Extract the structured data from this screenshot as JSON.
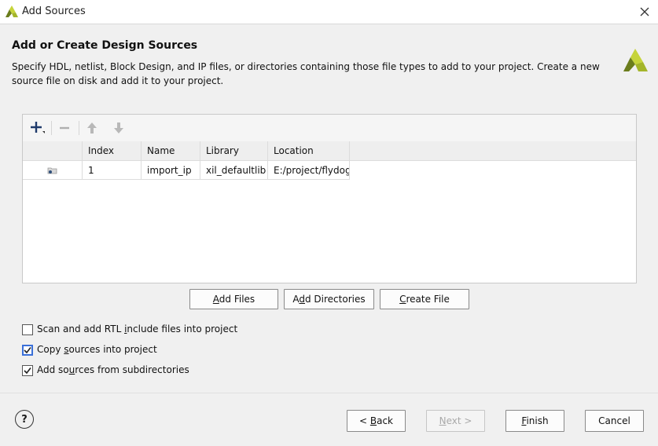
{
  "window": {
    "title": "Add Sources"
  },
  "header": {
    "heading": "Add or Create Design Sources",
    "description": "Specify HDL, netlist, Block Design, and IP files, or directories containing those file types to add to your project. Create a new source file on disk and add it to your project."
  },
  "table": {
    "columns": [
      "Index",
      "Name",
      "Library",
      "Location"
    ],
    "rows": [
      {
        "index": "1",
        "name": "import_ip",
        "library": "xil_defaultlib",
        "location": "E:/project/flydog"
      }
    ]
  },
  "actions": {
    "add_files": {
      "pre": "",
      "key": "A",
      "post": "dd Files"
    },
    "add_directories": {
      "pre": "A",
      "key": "d",
      "post": "d Directories"
    },
    "create_file": {
      "pre": "",
      "key": "C",
      "post": "reate File"
    }
  },
  "options": {
    "scan_rtl": {
      "pre": "Scan and add RTL ",
      "key": "i",
      "post": "nclude files into project",
      "checked": false
    },
    "copy_sources": {
      "pre": "Copy ",
      "key": "s",
      "post": "ources into project",
      "checked": true
    },
    "add_subdirs": {
      "pre": "Add so",
      "key": "u",
      "post": "rces from subdirectories",
      "checked": true
    }
  },
  "footer": {
    "help": "?",
    "back": {
      "pre": "< ",
      "key": "B",
      "post": "ack"
    },
    "next": {
      "pre": "",
      "key": "N",
      "post": "ext >"
    },
    "finish": {
      "pre": "",
      "key": "F",
      "post": "inish"
    },
    "cancel": "Cancel"
  },
  "colors": {
    "logo_light": "#c6d43a",
    "logo_dark": "#6b7d1c",
    "focus_blue": "#3a6fd8"
  }
}
